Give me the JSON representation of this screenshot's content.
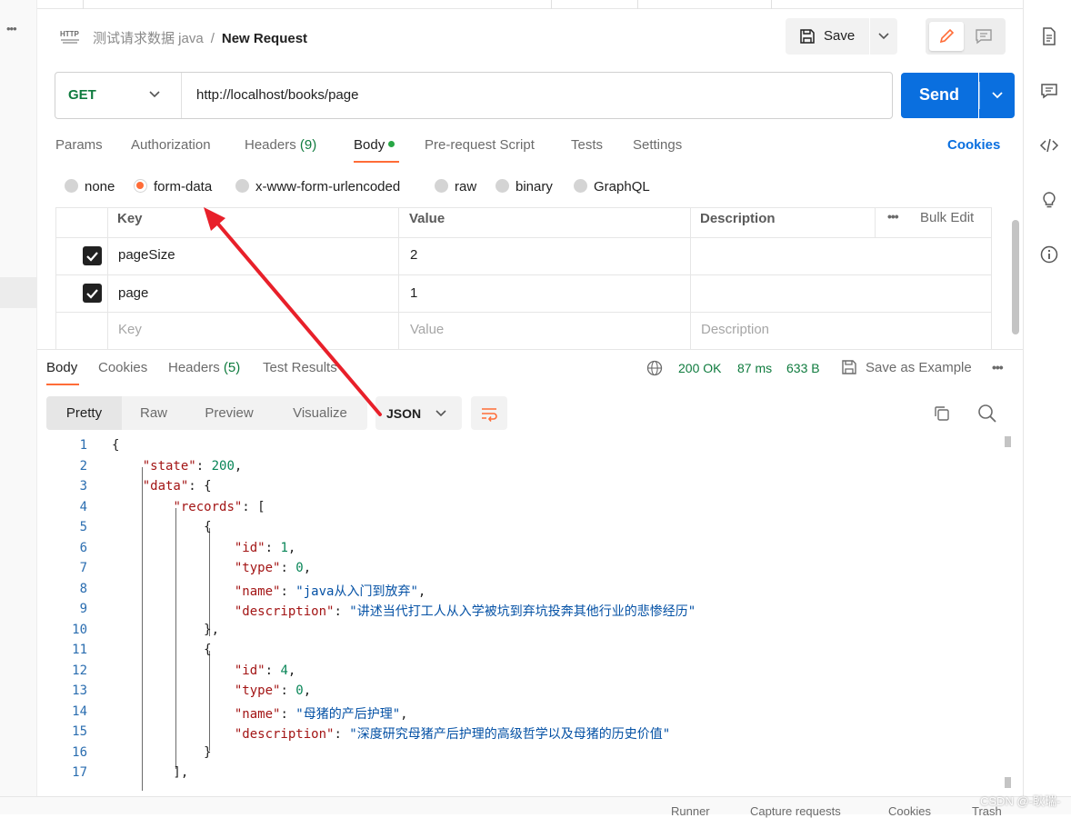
{
  "breadcrumb": {
    "collection": "测试请求数据 java",
    "separator": "/",
    "request": "New Request"
  },
  "header": {
    "method_badge": "HTTP",
    "save_label": "Save"
  },
  "request": {
    "method": "GET",
    "url": "http://localhost/books/page",
    "send_label": "Send"
  },
  "request_tabs": [
    {
      "label": "Params"
    },
    {
      "label": "Authorization"
    },
    {
      "label": "Headers",
      "count": "(9)"
    },
    {
      "label": "Body"
    },
    {
      "label": "Pre-request Script"
    },
    {
      "label": "Tests"
    },
    {
      "label": "Settings"
    }
  ],
  "cookies_label": "Cookies",
  "body_types": [
    "none",
    "form-data",
    "x-www-form-urlencoded",
    "raw",
    "binary",
    "GraphQL"
  ],
  "selected_body_type": "form-data",
  "params_table": {
    "headers": [
      "Key",
      "Value",
      "Description"
    ],
    "bulk_edit": "Bulk Edit",
    "rows": [
      {
        "checked": true,
        "key": "pageSize",
        "value": "2",
        "description": ""
      },
      {
        "checked": true,
        "key": "page",
        "value": "1",
        "description": ""
      }
    ],
    "placeholder": {
      "key": "Key",
      "value": "Value",
      "description": "Description"
    }
  },
  "response_tabs": [
    {
      "label": "Body"
    },
    {
      "label": "Cookies"
    },
    {
      "label": "Headers",
      "count": "(5)"
    },
    {
      "label": "Test Results"
    }
  ],
  "response_meta": {
    "status": "200 OK",
    "time": "87 ms",
    "size": "633 B",
    "save_example": "Save as Example"
  },
  "view_modes": [
    "Pretty",
    "Raw",
    "Preview",
    "Visualize"
  ],
  "format": "JSON",
  "code_lines": [
    {
      "n": "1",
      "text": "{"
    },
    {
      "n": "2",
      "text": "    \"state\": 200,"
    },
    {
      "n": "3",
      "text": "    \"data\": {"
    },
    {
      "n": "4",
      "text": "        \"records\": ["
    },
    {
      "n": "5",
      "text": "            {"
    },
    {
      "n": "6",
      "text": "                \"id\": 1,"
    },
    {
      "n": "7",
      "text": "                \"type\": 0,"
    },
    {
      "n": "8",
      "text": "                \"name\": \"java从入门到放弃\","
    },
    {
      "n": "9",
      "text": "                \"description\": \"讲述当代打工人从入学被坑到弃坑投奔其他行业的悲惨经历\""
    },
    {
      "n": "10",
      "text": "            },"
    },
    {
      "n": "11",
      "text": "            {"
    },
    {
      "n": "12",
      "text": "                \"id\": 4,"
    },
    {
      "n": "13",
      "text": "                \"type\": 0,"
    },
    {
      "n": "14",
      "text": "                \"name\": \"母猪的产后护理\","
    },
    {
      "n": "15",
      "text": "                \"description\": \"深度研究母猪产后护理的高级哲学以及母猪的历史价值\""
    },
    {
      "n": "16",
      "text": "            }"
    },
    {
      "n": "17",
      "text": "        ],"
    }
  ],
  "footer": [
    "Runner",
    "Capture requests",
    "Cookies",
    "Trash"
  ],
  "watermark": "CSDN @-耿瑞-",
  "colors": {
    "accent": "#ff6c37",
    "send": "#0a6fdf",
    "success": "#0f7b3e",
    "annotation_arrow": "#e8202a"
  }
}
